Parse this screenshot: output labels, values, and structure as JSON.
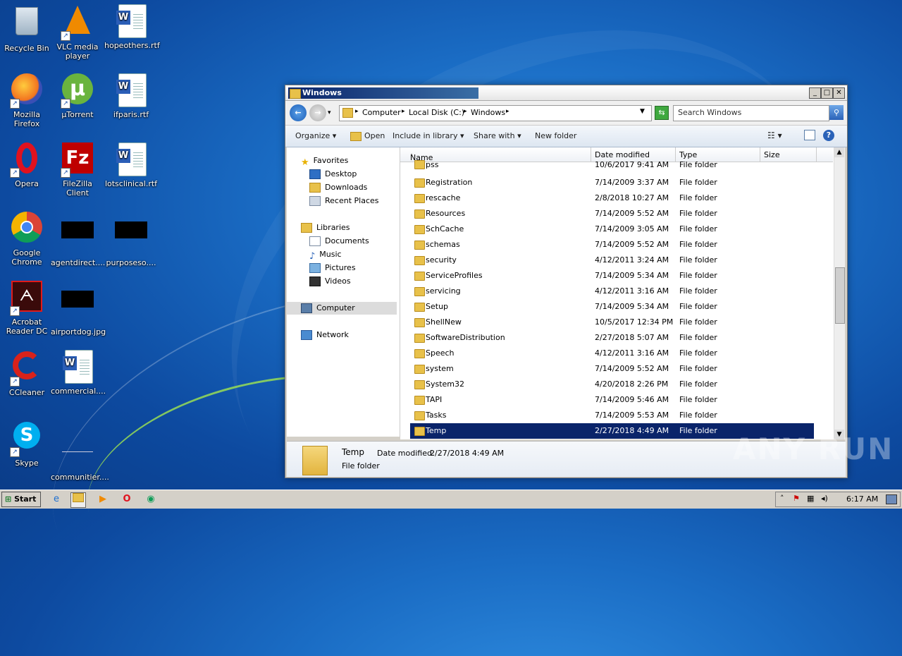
{
  "desktop": {
    "icons": [
      {
        "label": "Recycle Bin"
      },
      {
        "label": "VLC media player"
      },
      {
        "label": "hopeothers.rtf"
      },
      {
        "label": "Mozilla Firefox"
      },
      {
        "label": "µTorrent"
      },
      {
        "label": "ifparis.rtf"
      },
      {
        "label": "Opera"
      },
      {
        "label": "FileZilla Client"
      },
      {
        "label": "lotsclinical.rtf"
      },
      {
        "label": "Google Chrome"
      },
      {
        "label": "agentdirect...."
      },
      {
        "label": "purposeso...."
      },
      {
        "label": "Acrobat Reader DC"
      },
      {
        "label": "airportdog.jpg"
      },
      {
        "label": "CCleaner"
      },
      {
        "label": "commercial...."
      },
      {
        "label": "Skype"
      },
      {
        "label": "communitier...."
      }
    ]
  },
  "window": {
    "title": "Windows",
    "address": {
      "crumbs": [
        "Computer",
        "Local Disk (C:)",
        "Windows"
      ]
    },
    "search_placeholder": "Search Windows",
    "toolbar": {
      "organize": "Organize",
      "open": "Open",
      "include": "Include in library",
      "share": "Share with",
      "new_folder": "New folder"
    },
    "nav": {
      "favorites": "Favorites",
      "desktop": "Desktop",
      "downloads": "Downloads",
      "recent": "Recent Places",
      "libraries": "Libraries",
      "documents": "Documents",
      "music": "Music",
      "pictures": "Pictures",
      "videos": "Videos",
      "computer": "Computer",
      "network": "Network"
    },
    "columns": {
      "name": "Name",
      "date": "Date modified",
      "type": "Type",
      "size": "Size"
    },
    "files": [
      {
        "name": "pss",
        "date": "10/6/2017 9:41 AM",
        "type": "File folder"
      },
      {
        "name": "Registration",
        "date": "7/14/2009 3:37 AM",
        "type": "File folder"
      },
      {
        "name": "rescache",
        "date": "2/8/2018 10:27 AM",
        "type": "File folder"
      },
      {
        "name": "Resources",
        "date": "7/14/2009 5:52 AM",
        "type": "File folder"
      },
      {
        "name": "SchCache",
        "date": "7/14/2009 3:05 AM",
        "type": "File folder"
      },
      {
        "name": "schemas",
        "date": "7/14/2009 5:52 AM",
        "type": "File folder"
      },
      {
        "name": "security",
        "date": "4/12/2011 3:24 AM",
        "type": "File folder"
      },
      {
        "name": "ServiceProfiles",
        "date": "7/14/2009 5:34 AM",
        "type": "File folder"
      },
      {
        "name": "servicing",
        "date": "4/12/2011 3:16 AM",
        "type": "File folder"
      },
      {
        "name": "Setup",
        "date": "7/14/2009 5:34 AM",
        "type": "File folder"
      },
      {
        "name": "ShellNew",
        "date": "10/5/2017 12:34 PM",
        "type": "File folder"
      },
      {
        "name": "SoftwareDistribution",
        "date": "2/27/2018 5:07 AM",
        "type": "File folder"
      },
      {
        "name": "Speech",
        "date": "4/12/2011 3:16 AM",
        "type": "File folder"
      },
      {
        "name": "system",
        "date": "7/14/2009 5:52 AM",
        "type": "File folder"
      },
      {
        "name": "System32",
        "date": "4/20/2018 2:26 PM",
        "type": "File folder"
      },
      {
        "name": "TAPI",
        "date": "7/14/2009 5:46 AM",
        "type": "File folder"
      },
      {
        "name": "Tasks",
        "date": "7/14/2009 5:53 AM",
        "type": "File folder"
      },
      {
        "name": "Temp",
        "date": "2/27/2018 4:49 AM",
        "type": "File folder"
      }
    ],
    "details": {
      "name": "Temp",
      "date_label": "Date modified:",
      "date": "2/27/2018 4:49 AM",
      "type": "File folder"
    }
  },
  "taskbar": {
    "start": "Start",
    "clock": "6:17 AM"
  },
  "watermark": "ANY RUN"
}
